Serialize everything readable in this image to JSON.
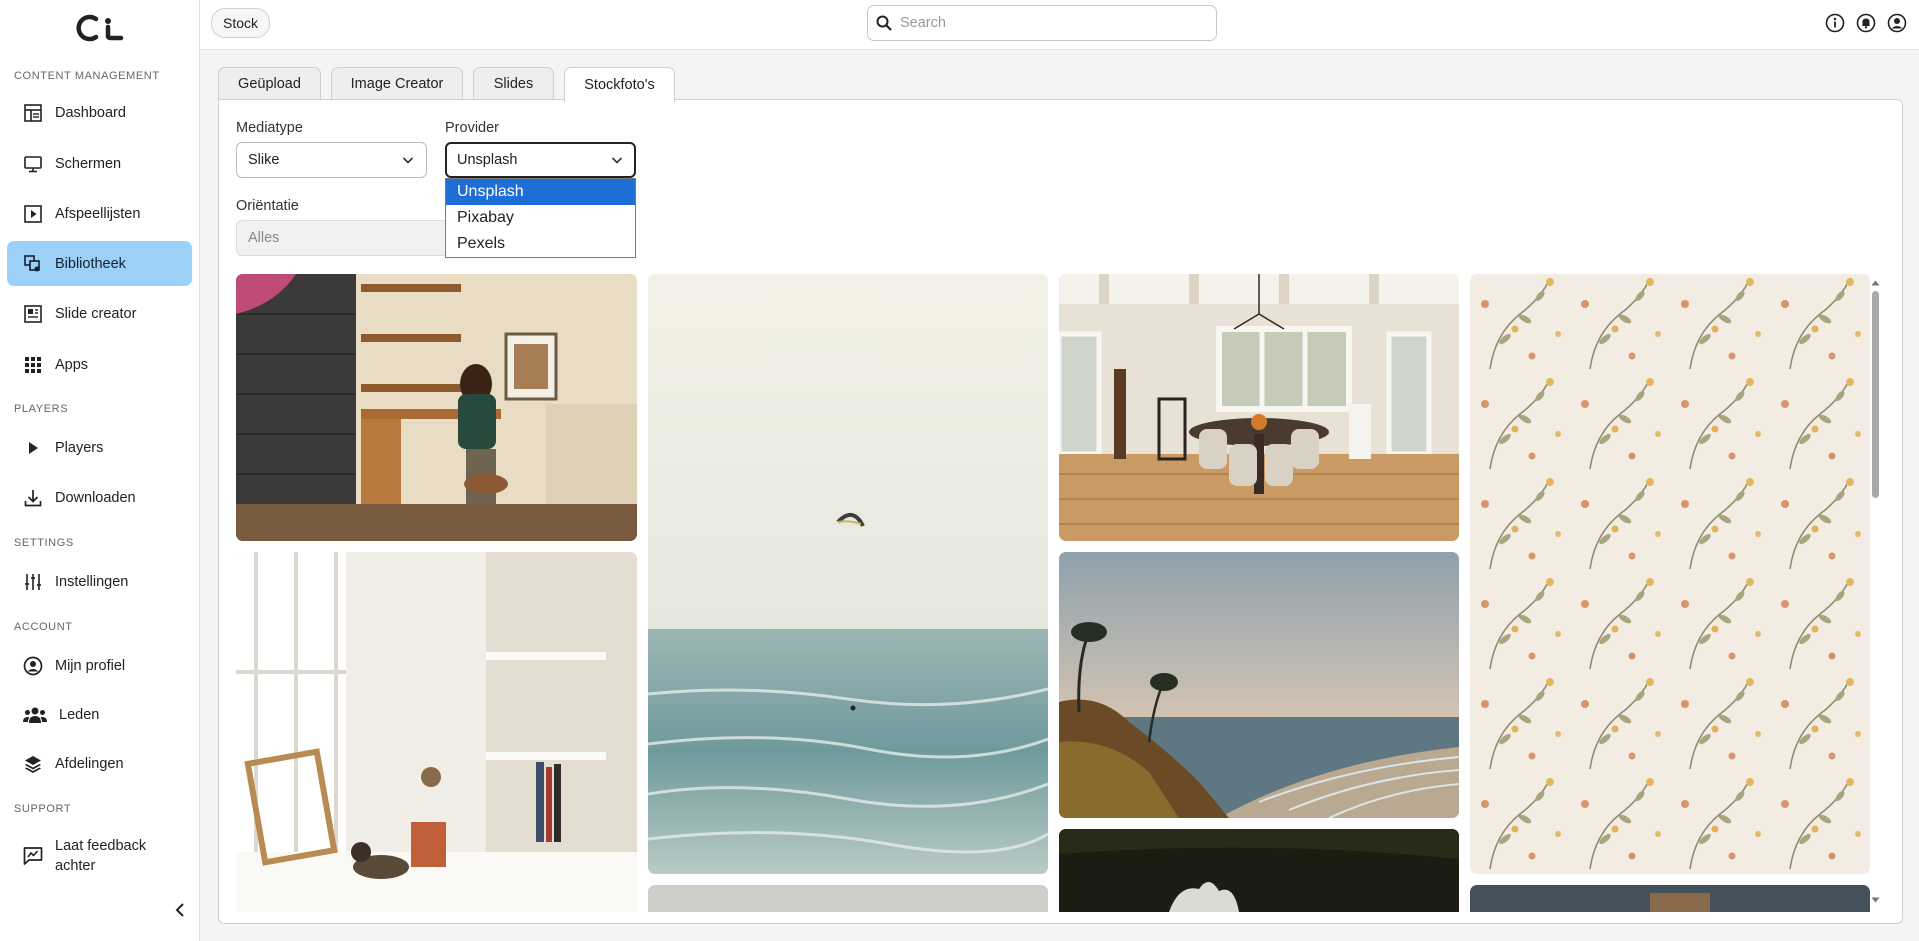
{
  "sidebar": {
    "sections": {
      "content": "CONTENT MANAGEMENT",
      "players": "PLAYERS",
      "settings": "SETTINGS",
      "account": "ACCOUNT",
      "support": "SUPPORT"
    },
    "items": {
      "dashboard": "Dashboard",
      "schermen": "Schermen",
      "afspeellijsten": "Afspeellijsten",
      "bibliotheek": "Bibliotheek",
      "slide_creator": "Slide creator",
      "apps": "Apps",
      "players": "Players",
      "downloaden": "Downloaden",
      "instellingen": "Instellingen",
      "mijn_profiel": "Mijn profiel",
      "leden": "Leden",
      "afdelingen": "Afdelingen",
      "feedback_line1": "Laat feedback",
      "feedback_line2": "achter"
    },
    "active": "bibliotheek"
  },
  "header": {
    "breadcrumb": "Stock",
    "search_placeholder": "Search"
  },
  "tabs": {
    "geupload": "Geüpload",
    "image_creator": "Image Creator",
    "slides": "Slides",
    "stockfotos": "Stockfoto's",
    "active": "stockfotos"
  },
  "filters": {
    "mediatype": {
      "label": "Mediatype",
      "value": "Slike"
    },
    "provider": {
      "label": "Provider",
      "value": "Unsplash",
      "options": [
        "Unsplash",
        "Pixabay",
        "Pexels"
      ]
    },
    "orientatie": {
      "label": "Oriëntatie",
      "value": "Alles"
    }
  },
  "colors": {
    "active_nav": "#9dd0f7",
    "selected_option": "#1d6ed6"
  }
}
